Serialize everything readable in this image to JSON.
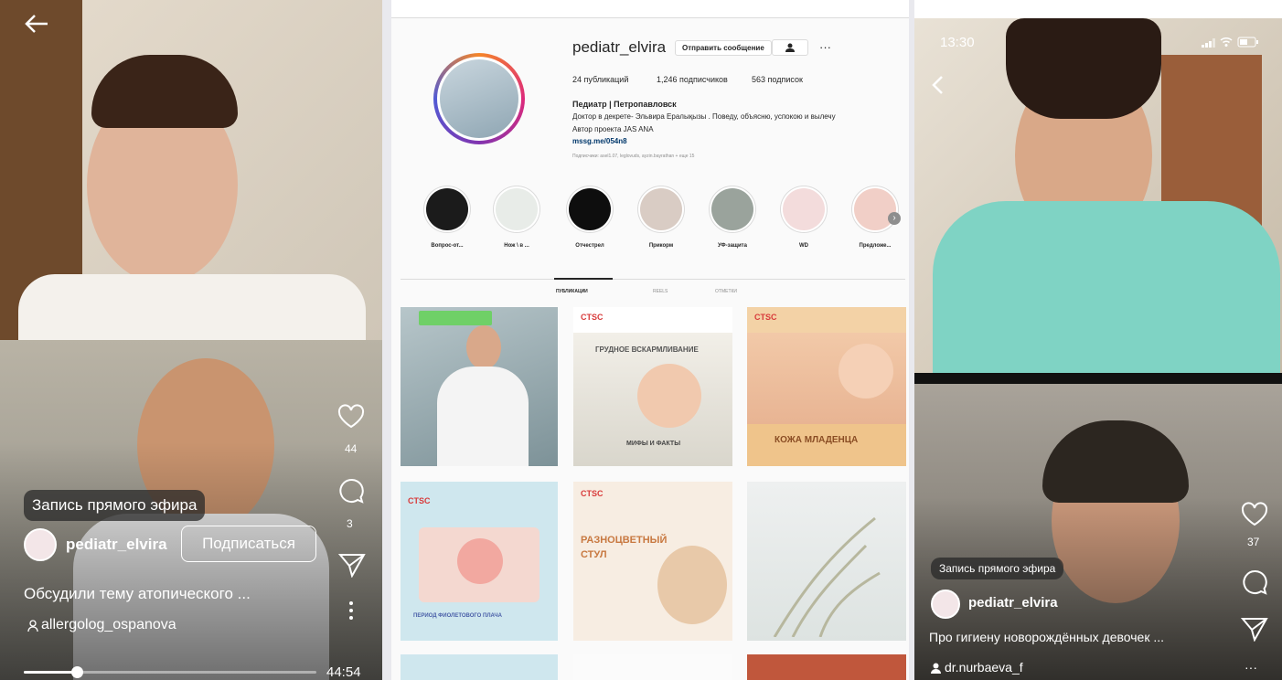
{
  "left": {
    "badge": "Запись прямого эфира",
    "username": "pediatr_elvira",
    "follow_label": "Подписаться",
    "caption": "Обсудили тему атопического ...",
    "guest": "allergolog_ospanova",
    "like_count": "44",
    "comment_count": "3",
    "time": "44:54",
    "progress": 0.18,
    "icons": [
      "back-arrow-icon",
      "heart-icon",
      "comment-icon",
      "share-icon",
      "more-vertical-icon"
    ]
  },
  "profile": {
    "username": "pediatr_elvira",
    "message_button": "Отправить сообщение",
    "stats": {
      "posts": "24 публикаций",
      "followers": "1,246 подписчиков",
      "following": "563 подписок"
    },
    "name": "Педиатр | Петропавловск",
    "bio1": "Доктор в декрете- Эльвира Ералықызы . Поведу, объясню, успокою и вылечу",
    "bio2": "Автор проекта JAS ANA",
    "link": "mssg.me/054n8",
    "followed_by": "Подписчики: asel1.07, leglovuds, ayzin.bayrathan + еще 15",
    "highlights": [
      "Вопрос-от...",
      "Нож \\ в ...",
      "Отчестрел",
      "Прикорм",
      "УФ-защита",
      "WD",
      "Предложе..."
    ],
    "tabs": [
      "ПУБЛИКАЦИИ",
      "REELS",
      "ОТМЕТКИ"
    ],
    "posts": [
      {
        "caption": ""
      },
      {
        "caption": "ГРУДНОЕ ВСКАРМЛИВАНИЕ",
        "caption2": "МИФЫ И ФАКТЫ"
      },
      {
        "caption": "КОЖА МЛАДЕНЦА"
      },
      {
        "caption": "ПЕРИОД ФИОЛЕТОВОГО ПЛАЧА"
      },
      {
        "caption": "РАЗНОЦВЕТНЫЙ СТУЛ"
      },
      {
        "caption": ""
      }
    ],
    "logo_text": "CTSC"
  },
  "right": {
    "clock": "13:30",
    "badge": "Запись прямого эфира",
    "username": "pediatr_elvira",
    "caption": "Про гигиену новорождённых девочек ...",
    "guest": "dr.nurbaeva_f",
    "like_count": "37",
    "icons": [
      "back-chevron-icon",
      "signal-icon",
      "wifi-icon",
      "battery-icon",
      "heart-icon",
      "comment-icon",
      "share-icon",
      "more-icon"
    ]
  },
  "colors": {
    "accent": "#3897f0",
    "pink": "#e1306c",
    "mint": "#7fd3c4",
    "tan": "#f3d2a6"
  }
}
